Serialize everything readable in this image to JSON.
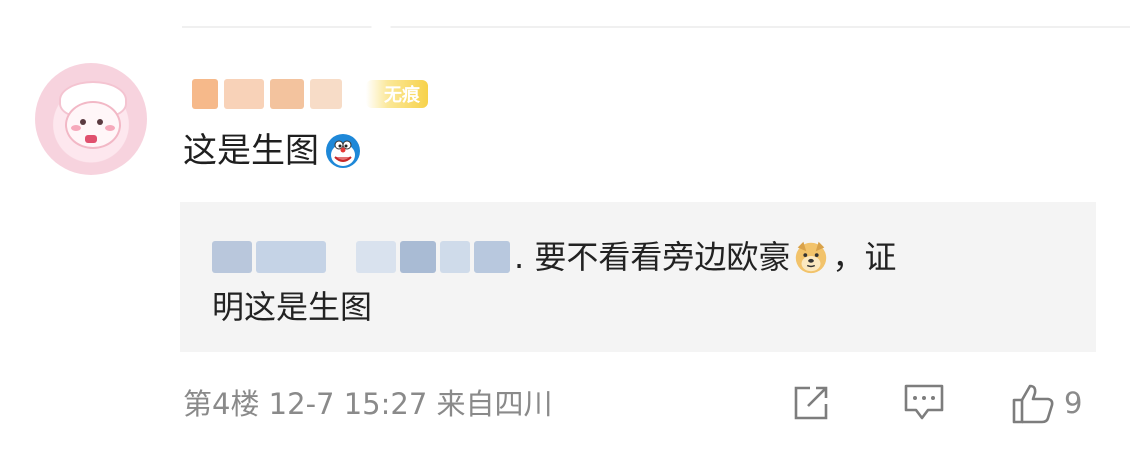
{
  "post": {
    "comment_text": "这是生图",
    "badge": "无痕",
    "quote_tail": ". 要不看看旁边欧豪",
    "quote_after_emoji": "，证",
    "quote_line2": "明这是生图",
    "meta": "第4楼 12-7 15:27 来自四川",
    "like_count": "9"
  },
  "icons": {
    "emoji_1": "doraemon-emoji",
    "emoji_2": "doge-emoji",
    "share": "share-icon",
    "comment": "comment-icon",
    "like": "thumbs-up-icon"
  },
  "colors": {
    "link": "#4a70a8",
    "meta_text": "#8a8a8a",
    "quote_bg": "#f4f4f4",
    "badge": "#f7d24a"
  }
}
